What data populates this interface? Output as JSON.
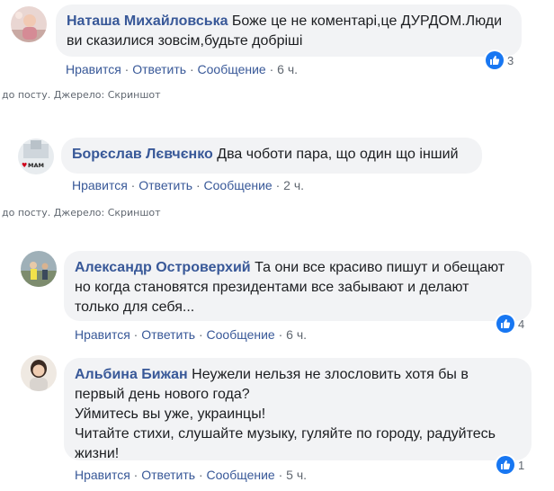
{
  "colors": {
    "author": "#385898",
    "bubble": "#f2f3f5",
    "like": "#1877f2"
  },
  "comments": [
    {
      "author": "Наташа Михайловська",
      "text": "Боже це не коментарі,це ДУРДОМ.Люди ви сказилися зовсім,будьте добріші",
      "actions": {
        "like": "Нравится",
        "reply": "Ответить",
        "message": "Сообщение",
        "time": "6 ч."
      },
      "reactions": {
        "icon": "like-icon",
        "count": "3"
      }
    },
    {
      "author": "Борєслав Лєвчєнко",
      "text": "Два чоботи пара, що один що інший",
      "actions": {
        "like": "Нравится",
        "reply": "Ответить",
        "message": "Сообщение",
        "time": "2 ч."
      }
    },
    {
      "author": "Александр Островерхий",
      "text": "Та они все красиво пишут и обещают но когда становятся президентами все забывают и делают только для себя...",
      "actions": {
        "like": "Нравится",
        "reply": "Ответить",
        "message": "Сообщение",
        "time": "6 ч."
      },
      "reactions": {
        "icon": "like-icon",
        "count": "4"
      }
    },
    {
      "author": "Альбина Бижан",
      "text_lines": [
        "Неужели нельзя не злословить хотя бы в первый день нового года?",
        "Уймитесь вы уже, украинцы!",
        "Читайте стихи, слушайте музыку, гуляйте по городу, радуйтесь жизни!"
      ],
      "actions": {
        "like": "Нравится",
        "reply": "Ответить",
        "message": "Сообщение",
        "time": "5 ч."
      },
      "reactions": {
        "icon": "like-icon",
        "count": "1"
      }
    }
  ],
  "source_captions": [
    "до посту. Джерело: Скриншот",
    "до посту. Джерело: Скриншот"
  ],
  "separator": "·"
}
